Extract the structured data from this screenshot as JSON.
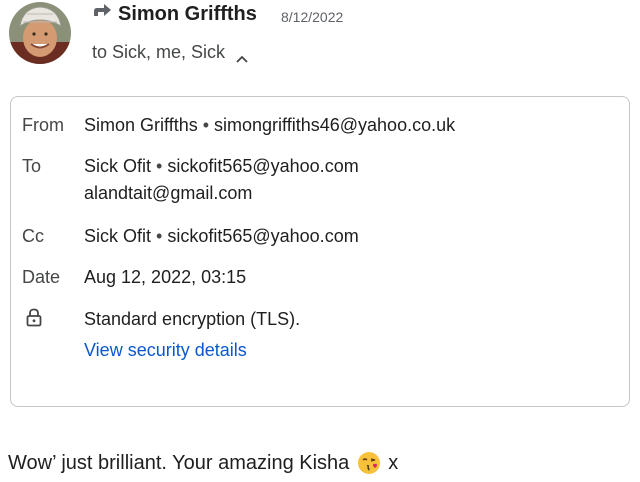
{
  "header": {
    "sender_name": "Simon Griffths",
    "date": "8/12/2022",
    "recipients_summary": "to Sick, me, Sick",
    "avatar_icon": "avatar-photo",
    "forward_icon": "forward-arrow-icon",
    "expand_icon": "chevron-up-icon"
  },
  "details": {
    "from_label": "From",
    "from_name": "Simon Griffths",
    "from_email": "simongriffiths46@yahoo.co.uk",
    "to_label": "To",
    "to_name": "Sick Ofit",
    "to_email": "sickofit565@yahoo.com",
    "to_email_2": "alandtait@gmail.com",
    "cc_label": "Cc",
    "cc_name": "Sick Ofit",
    "cc_email": "sickofit565@yahoo.com",
    "date_label": "Date",
    "date_value": "Aug 12, 2022, 03:15",
    "encryption_icon": "lock-icon",
    "encryption_text": "Standard encryption (TLS).",
    "security_link": "View security details"
  },
  "message": {
    "body_text": "Wow’ just brilliant. Your amazing Kisha",
    "emoji": "face-blowing-kiss",
    "trailing_text": "x"
  },
  "colors": {
    "link": "#0b57d0",
    "card_border": "#c4c7c5",
    "secondary_text": "#444746"
  }
}
